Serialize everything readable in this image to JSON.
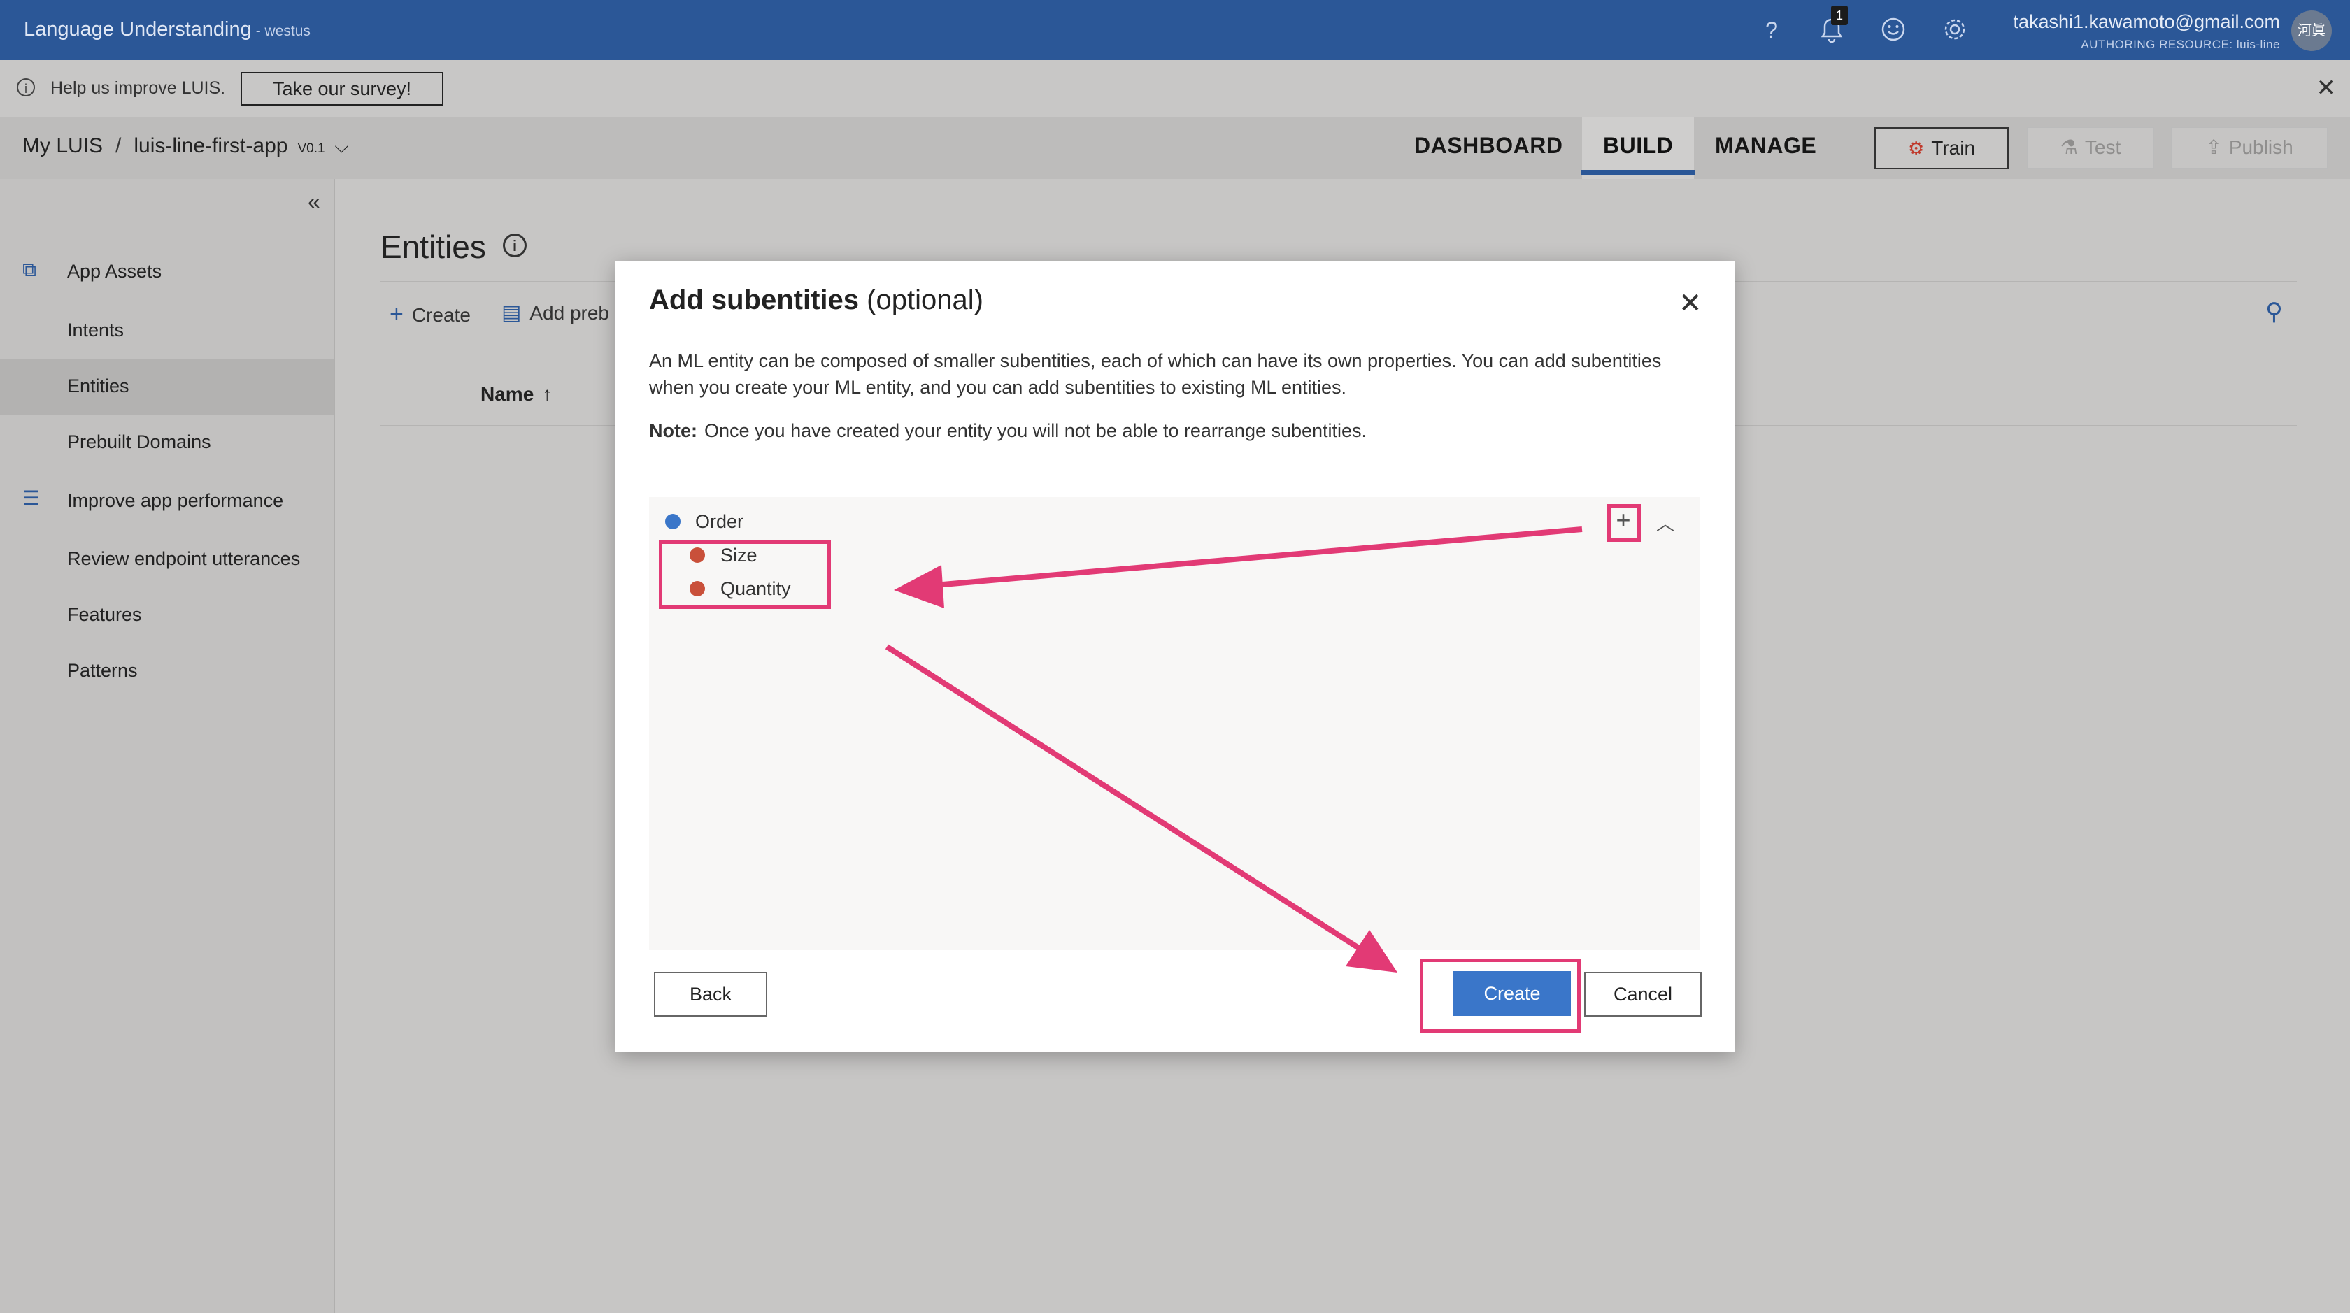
{
  "topbar": {
    "app_name": "Language Understanding",
    "region": "- westus",
    "help_icon": "?",
    "notification_count": "1",
    "user_email": "takashi1.kawamoto@gmail.com",
    "authoring_resource": "AUTHORING RESOURCE:  luis-line",
    "avatar_initials": "河眞"
  },
  "survey": {
    "message": "Help us improve LUIS.",
    "button_label": "Take our survey!"
  },
  "app_header": {
    "my_luis": "My LUIS",
    "separator": "/",
    "app_name": "luis-line-first-app",
    "version": "V0.1",
    "tabs": [
      {
        "label": "DASHBOARD"
      },
      {
        "label": "BUILD"
      },
      {
        "label": "MANAGE"
      }
    ],
    "train_label": "Train",
    "test_label": "Test",
    "publish_label": "Publish",
    "active_tab": "BUILD"
  },
  "sidebar": {
    "items": [
      {
        "label": "App Assets"
      },
      {
        "label": "Intents"
      },
      {
        "label": "Entities"
      },
      {
        "label": "Prebuilt Domains"
      },
      {
        "label": "Improve app performance"
      },
      {
        "label": "Review endpoint utterances"
      },
      {
        "label": "Features"
      },
      {
        "label": "Patterns"
      }
    ],
    "selected": "Entities"
  },
  "main": {
    "title": "Entities",
    "toolbar": {
      "create_label": "Create",
      "add_prebuilt_label": "Add preb"
    },
    "column_name": "Name"
  },
  "modal": {
    "title": "Add subentities",
    "title_suffix": "(optional)",
    "description": "An ML entity can be composed of smaller subentities, each of which can have its own properties. You can add subentities when you create your ML entity, and you can add subentities to existing ML entities.",
    "note_label": "Note:",
    "note_text": "Once you have created your entity you will not be able to rearrange subentities.",
    "tree": {
      "root": {
        "label": "Order",
        "color": "#3a76c9"
      },
      "children": [
        {
          "label": "Size",
          "color": "#c9503a"
        },
        {
          "label": "Quantity",
          "color": "#c9503a"
        }
      ]
    },
    "back_label": "Back",
    "create_label": "Create",
    "cancel_label": "Cancel"
  },
  "colors": {
    "accent": "#2b5797",
    "primary_button": "#3a76c9",
    "annotation": "#e23a75"
  }
}
